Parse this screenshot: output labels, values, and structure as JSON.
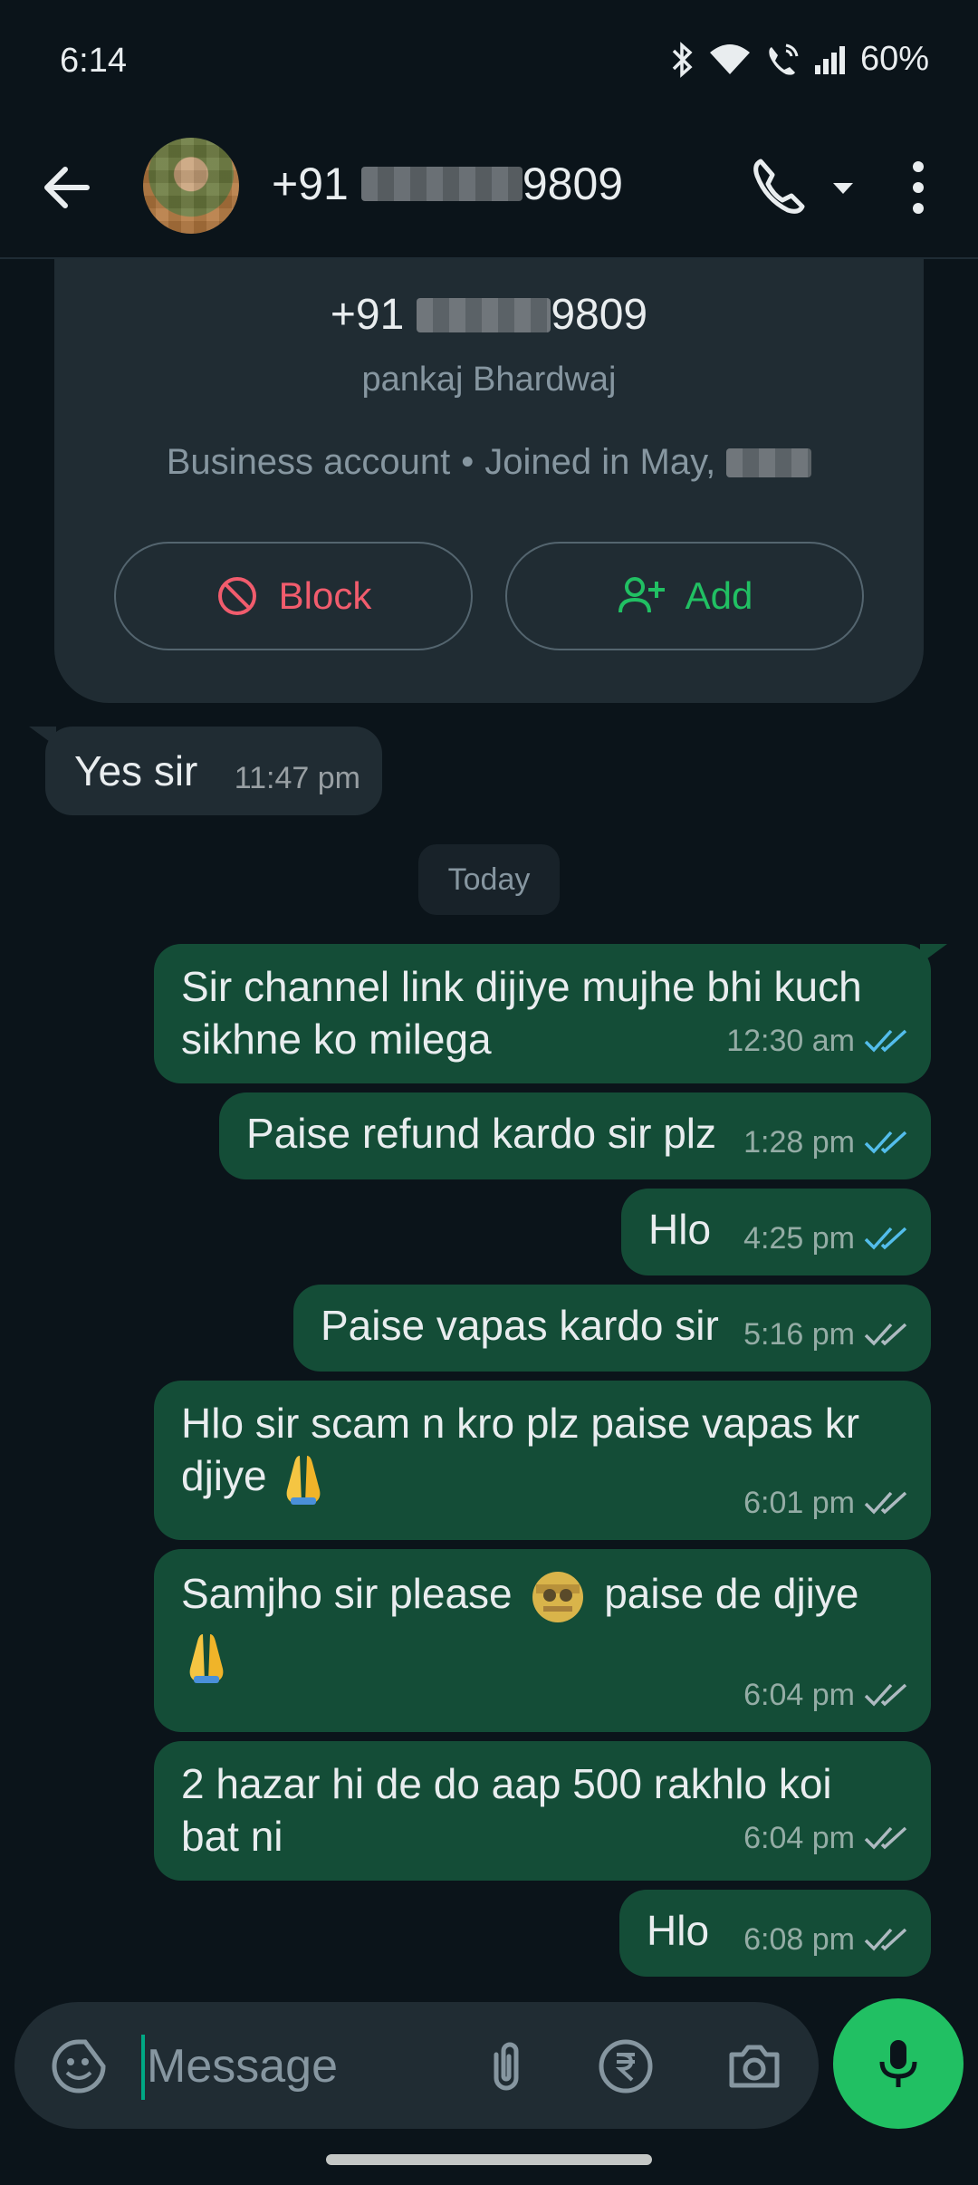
{
  "status_bar": {
    "time": "6:14",
    "battery": "60%"
  },
  "header": {
    "number_prefix": "+91",
    "number_suffix": "9809",
    "avatar_label": "contact photo"
  },
  "profile_card": {
    "number_prefix": "+91",
    "number_suffix": "9809",
    "name": "pankaj Bhardwaj",
    "account_type": "Business account",
    "joined": "Joined in May,",
    "block_label": "Block",
    "add_label": "Add"
  },
  "date_chip": "Today",
  "messages": [
    {
      "text": "Yes sir",
      "time": "11:47 pm",
      "direction": "incoming"
    },
    {
      "text": "Sir channel link dijiye mujhe bhi kuch sikhne ko milega",
      "time": "12:30 am",
      "direction": "outgoing",
      "status": "read"
    },
    {
      "text": "Paise refund kardo sir plz",
      "time": "1:28 pm",
      "direction": "outgoing",
      "status": "read"
    },
    {
      "text": "Hlo",
      "time": "4:25 pm",
      "direction": "outgoing",
      "status": "read"
    },
    {
      "text": "Paise vapas kardo sir",
      "time": "5:16 pm",
      "direction": "outgoing",
      "status": "delivered"
    },
    {
      "text": "Hlo sir scam n kro plz paise vapas kr djiye",
      "time": "6:01 pm",
      "direction": "outgoing",
      "status": "delivered"
    },
    {
      "text_before": "Samjho sir please",
      "text_after": "paise de djiye",
      "time": "6:04 pm",
      "direction": "outgoing",
      "status": "delivered"
    },
    {
      "text": "2 hazar hi de do aap 500 rakhlo koi bat ni",
      "time": "6:04 pm",
      "direction": "outgoing",
      "status": "delivered"
    },
    {
      "text": "Hlo",
      "time": "6:08 pm",
      "direction": "outgoing",
      "status": "delivered"
    }
  ],
  "composer": {
    "placeholder": "Message"
  },
  "colors": {
    "background": "#0b141a",
    "outgoing_bubble": "#144d37",
    "incoming_bubble": "#202c33",
    "accent_green": "#21c063",
    "read_tick": "#53bdeb",
    "block_red": "#f15c6d"
  }
}
